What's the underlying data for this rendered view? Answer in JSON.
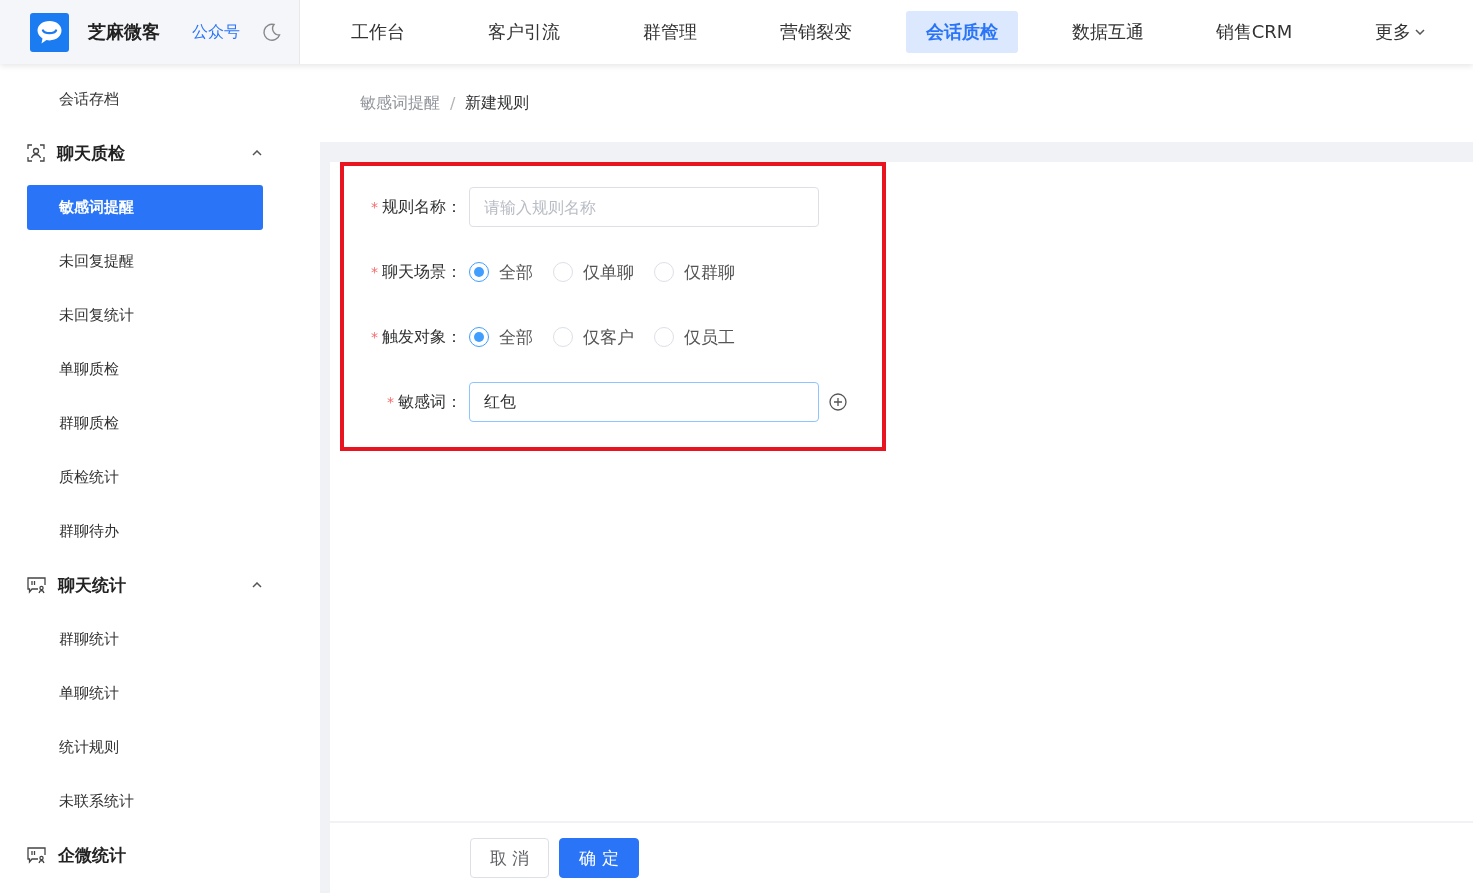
{
  "header": {
    "brand": "芝麻微客",
    "account_link": "公众号",
    "nav": [
      {
        "label": "工作台",
        "selected": false
      },
      {
        "label": "客户引流",
        "selected": false
      },
      {
        "label": "群管理",
        "selected": false
      },
      {
        "label": "营销裂变",
        "selected": false
      },
      {
        "label": "会话质检",
        "selected": true
      },
      {
        "label": "数据互通",
        "selected": false
      },
      {
        "label": "销售CRM",
        "selected": false
      },
      {
        "label": "更多",
        "selected": false,
        "has_menu": true
      }
    ]
  },
  "sidebar": {
    "items": [
      {
        "kind": "item",
        "label": "会话存档",
        "selected": false
      },
      {
        "kind": "group",
        "label": "聊天质检",
        "expanded": true,
        "children": [
          {
            "kind": "item",
            "label": "敏感词提醒",
            "selected": true
          },
          {
            "kind": "item",
            "label": "未回复提醒",
            "selected": false
          },
          {
            "kind": "item",
            "label": "未回复统计",
            "selected": false
          },
          {
            "kind": "item",
            "label": "单聊质检",
            "selected": false
          },
          {
            "kind": "item",
            "label": "群聊质检",
            "selected": false
          },
          {
            "kind": "item",
            "label": "质检统计",
            "selected": false
          },
          {
            "kind": "item",
            "label": "群聊待办",
            "selected": false
          }
        ]
      },
      {
        "kind": "group",
        "label": "聊天统计",
        "expanded": true,
        "children": [
          {
            "kind": "item",
            "label": "群聊统计",
            "selected": false
          },
          {
            "kind": "item",
            "label": "单聊统计",
            "selected": false
          },
          {
            "kind": "item",
            "label": "统计规则",
            "selected": false
          },
          {
            "kind": "item",
            "label": "未联系统计",
            "selected": false
          }
        ]
      },
      {
        "kind": "group",
        "label": "企微统计"
      }
    ]
  },
  "breadcrumb": {
    "items": [
      "敏感词提醒",
      "新建规则"
    ],
    "separator": "/"
  },
  "form": {
    "fields": [
      {
        "kind": "text",
        "label": "规则名称：",
        "required_mark": "*",
        "placeholder": "请输入规则名称"
      },
      {
        "kind": "radio",
        "label": "聊天场景：",
        "required_mark": "*",
        "options": [
          {
            "label": "全部",
            "selected": true
          },
          {
            "label": "仅单聊",
            "selected": false
          },
          {
            "label": "仅群聊",
            "selected": false
          }
        ]
      },
      {
        "kind": "radio",
        "label": "触发对象：",
        "required_mark": "*",
        "options": [
          {
            "label": "全部",
            "selected": true
          },
          {
            "label": "仅客户",
            "selected": false
          },
          {
            "label": "仅员工",
            "selected": false
          }
        ]
      },
      {
        "kind": "text",
        "label": "敏感词：",
        "required_mark": "*",
        "value": "红包",
        "focused": true,
        "addable": true
      }
    ]
  },
  "footer": {
    "buttons": [
      {
        "label": "取 消",
        "primary": false
      },
      {
        "label": "确 定",
        "primary": true
      }
    ]
  }
}
